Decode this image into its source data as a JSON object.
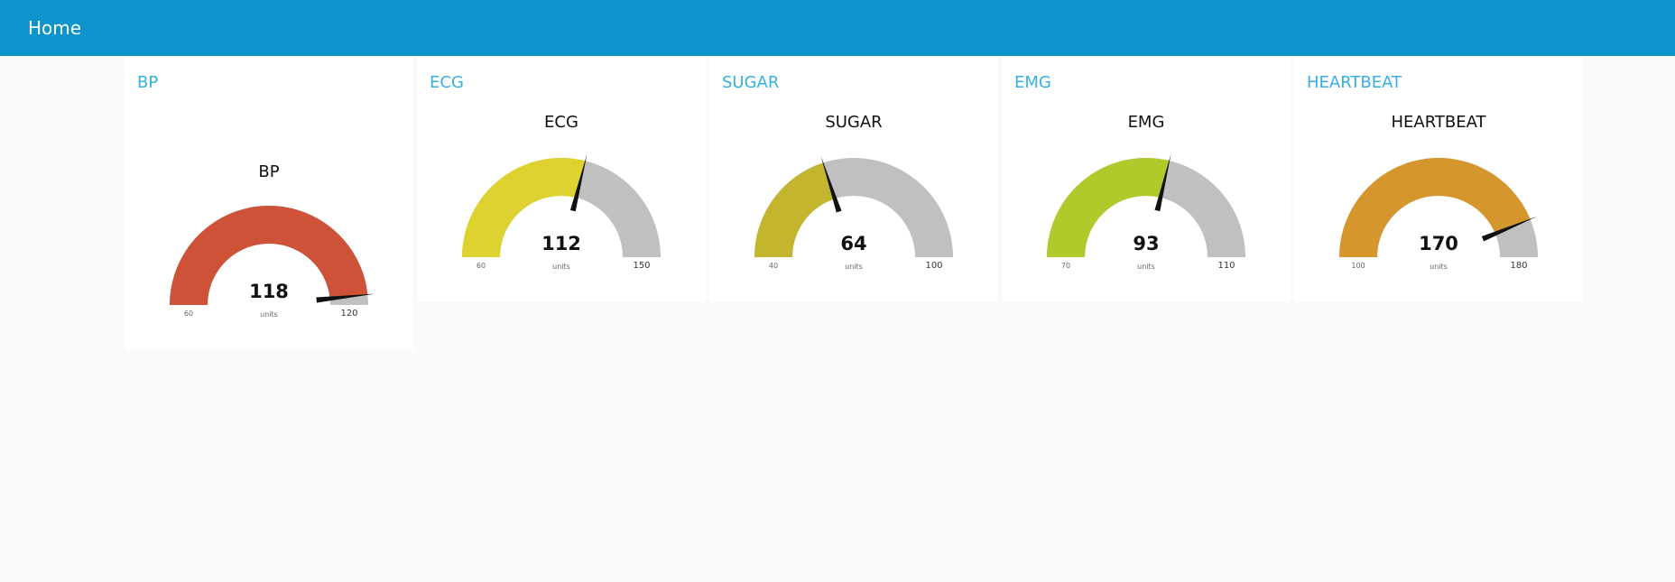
{
  "header": {
    "title": "Home"
  },
  "colors": {
    "bar": "#0e94cc",
    "groupTitle": "#36b0e3",
    "track": "#c0c0c0",
    "needle": "#111111"
  },
  "gauges": [
    {
      "group": "BP",
      "label": "BP",
      "value": 118,
      "units": "units",
      "min": 60,
      "max": 120,
      "color": "#cd5237"
    },
    {
      "group": "ECG",
      "label": "ECG",
      "value": 112,
      "units": "units",
      "min": 60,
      "max": 150,
      "color": "#ded230"
    },
    {
      "group": "SUGAR",
      "label": "SUGAR",
      "value": 64,
      "units": "units",
      "min": 40,
      "max": 100,
      "color": "#c3b52d"
    },
    {
      "group": "EMG",
      "label": "EMG",
      "value": 93,
      "units": "units",
      "min": 70,
      "max": 110,
      "color": "#b1c92b"
    },
    {
      "group": "HEARTBEAT",
      "label": "HEARTBEAT",
      "value": 170,
      "units": "units",
      "min": 100,
      "max": 180,
      "color": "#d6962e"
    }
  ]
}
